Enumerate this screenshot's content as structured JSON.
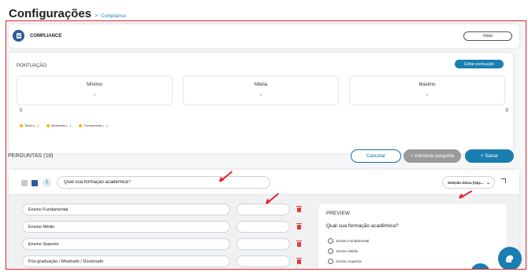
{
  "header": {
    "title": "Configurações",
    "separator": ">",
    "breadcrumb": "Compliance"
  },
  "compliance": {
    "label": "COMPLIANCE",
    "back_label": "Voltar"
  },
  "score": {
    "title": "PONTUAÇÃO",
    "edit_label": "Editar pontuação",
    "metrics": [
      {
        "label": "Mínimo",
        "value": "-"
      },
      {
        "label": "Média",
        "value": "-"
      },
      {
        "label": "Máximo",
        "value": "-"
      }
    ],
    "axis_min": "0",
    "axis_max": "0",
    "legend": [
      {
        "label": "Tesão ( - )",
        "color": "#f2b705"
      },
      {
        "label": "Moderado ( - )",
        "color": "#f2b705"
      },
      {
        "label": "Conservador ( - )",
        "color": "#f2b705"
      }
    ]
  },
  "questions": {
    "title": "PERGUNTAS (18)",
    "cancel_label": "Cancelar",
    "add_label": "+ Adicionar pergunta",
    "save_label": "+ Salvar",
    "current": {
      "number": "1",
      "text": "Qual sua formação acadêmica?",
      "type": "Seleção Única (Opç...",
      "options": [
        "Ensino Fundamental",
        "Ensino Médio",
        "Ensino Superior",
        "Pós-graduação / Mestrado / Doutorado"
      ]
    },
    "preview": {
      "title": "PREVIEW",
      "question": "Qual sua formação acadêmica?",
      "options": [
        "Ensino Fundamental",
        "Ensino Médio",
        "Ensino Superior"
      ]
    }
  },
  "colors": {
    "accent": "#1a7eb0",
    "highlight": "#e0262d",
    "legend_dot": "#f2b705"
  }
}
